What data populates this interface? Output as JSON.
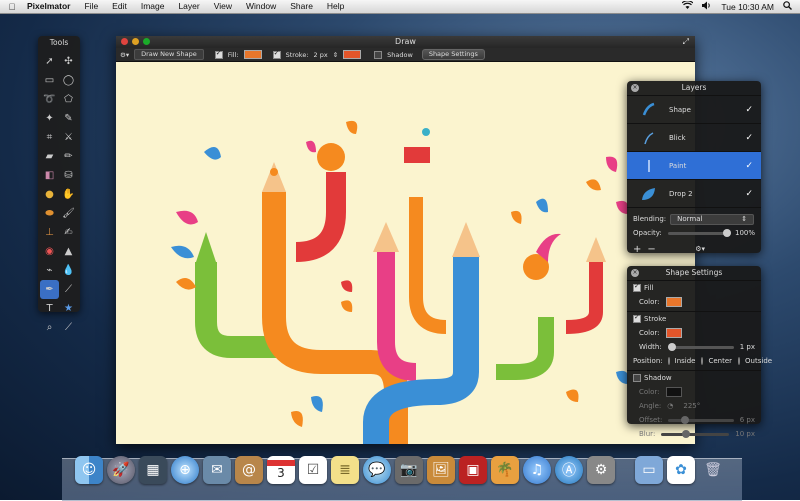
{
  "menubar": {
    "app_name": "Pixelmator",
    "items": [
      "File",
      "Edit",
      "Image",
      "Layer",
      "View",
      "Window",
      "Share",
      "Help"
    ],
    "clock": "Tue 10:30 AM"
  },
  "tools_panel": {
    "title": "Tools"
  },
  "window": {
    "title": "Draw",
    "toolbar": {
      "mode": "Draw New Shape",
      "fill_label": "Fill:",
      "fill_color": "#e8762b",
      "stroke_label": "Stroke:",
      "stroke_width": "2 px",
      "stroke_color": "#e2552a",
      "shadow_label": "Shadow",
      "shape_settings_button": "Shape Settings"
    }
  },
  "layers_panel": {
    "title": "Layers",
    "layers": [
      {
        "name": "Shape",
        "visible": true,
        "selected": false
      },
      {
        "name": "Blick",
        "visible": true,
        "selected": false
      },
      {
        "name": "Paint",
        "visible": true,
        "selected": true
      },
      {
        "name": "Drop 2",
        "visible": true,
        "selected": false
      }
    ],
    "blending_label": "Blending:",
    "blending_value": "Normal",
    "opacity_label": "Opacity:",
    "opacity_value": "100%"
  },
  "shape_settings": {
    "title": "Shape Settings",
    "fill_label": "Fill",
    "fill_color_label": "Color:",
    "fill_color": "#e8762b",
    "stroke_label": "Stroke",
    "stroke_color_label": "Color:",
    "stroke_color": "#e2552a",
    "width_label": "Width:",
    "width_value": "1 px",
    "position_label": "Position:",
    "position_options": [
      "Inside",
      "Center",
      "Outside"
    ],
    "position_selected": "Center",
    "shadow_label": "Shadow",
    "shadow_color_label": "Color:",
    "angle_label": "Angle:",
    "angle_value": "225°",
    "offset_label": "Offset:",
    "offset_value": "6 px",
    "blur_label": "Blur:",
    "blur_value": "10 px"
  },
  "dock": {
    "icons": [
      "finder-icon",
      "launchpad-icon",
      "mission-control-icon",
      "safari-icon",
      "mail-icon",
      "contacts-icon",
      "calendar-icon",
      "reminders-icon",
      "notes-icon",
      "messages-icon",
      "facetime-icon",
      "preview-icon",
      "photo-booth-icon",
      "iphoto-icon",
      "itunes-icon",
      "app-store-icon",
      "system-preferences-icon",
      "downloads-icon",
      "pixelmator-icon",
      "trash-icon"
    ],
    "calendar_day": "3"
  }
}
